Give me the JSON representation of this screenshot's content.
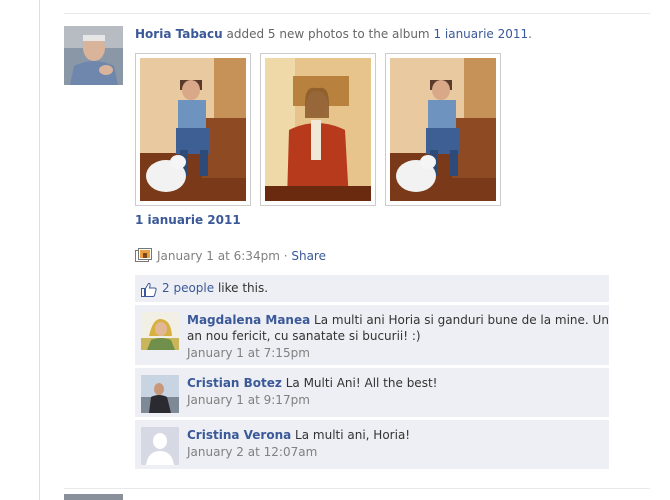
{
  "story": {
    "actor_name": "Horia Tabacu",
    "action_text": " added 5 new photos to the album ",
    "album_name": "1 ianuarie 2011",
    "period": ".",
    "album_link": "1 ianuarie 2011",
    "timestamp": "January 1 at 6:34pm",
    "separator": " · ",
    "share_label": "Share",
    "photos": [
      {
        "icon": "photo-man-on-sofa-with-dog"
      },
      {
        "icon": "photo-woman-in-red-jacket"
      },
      {
        "icon": "photo-man-on-sofa-with-dog"
      }
    ]
  },
  "likes": {
    "count_text": "2 people",
    "suffix": " like this."
  },
  "comments": [
    {
      "author": "Magdalena Manea",
      "text": " La multi ani Horia si ganduri bune de la mine. Un an nou fericit, cu sanatate si bucurii! :)",
      "time": "January 1 at 7:15pm",
      "avatar_icon": "avatar-woman-photo"
    },
    {
      "author": "Cristian Botez",
      "text": " La Multi Ani! All the best!",
      "time": "January 1 at 9:17pm",
      "avatar_icon": "avatar-man-photo"
    },
    {
      "author": "Cristina Verona",
      "text": " La multi ani, Horia!",
      "time": "January 2 at 12:07am",
      "avatar_icon": "default-silhouette-avatar"
    }
  ],
  "colors": {
    "link": "#3b5998",
    "ufi_background": "#edeff4",
    "muted_text": "#808080"
  }
}
